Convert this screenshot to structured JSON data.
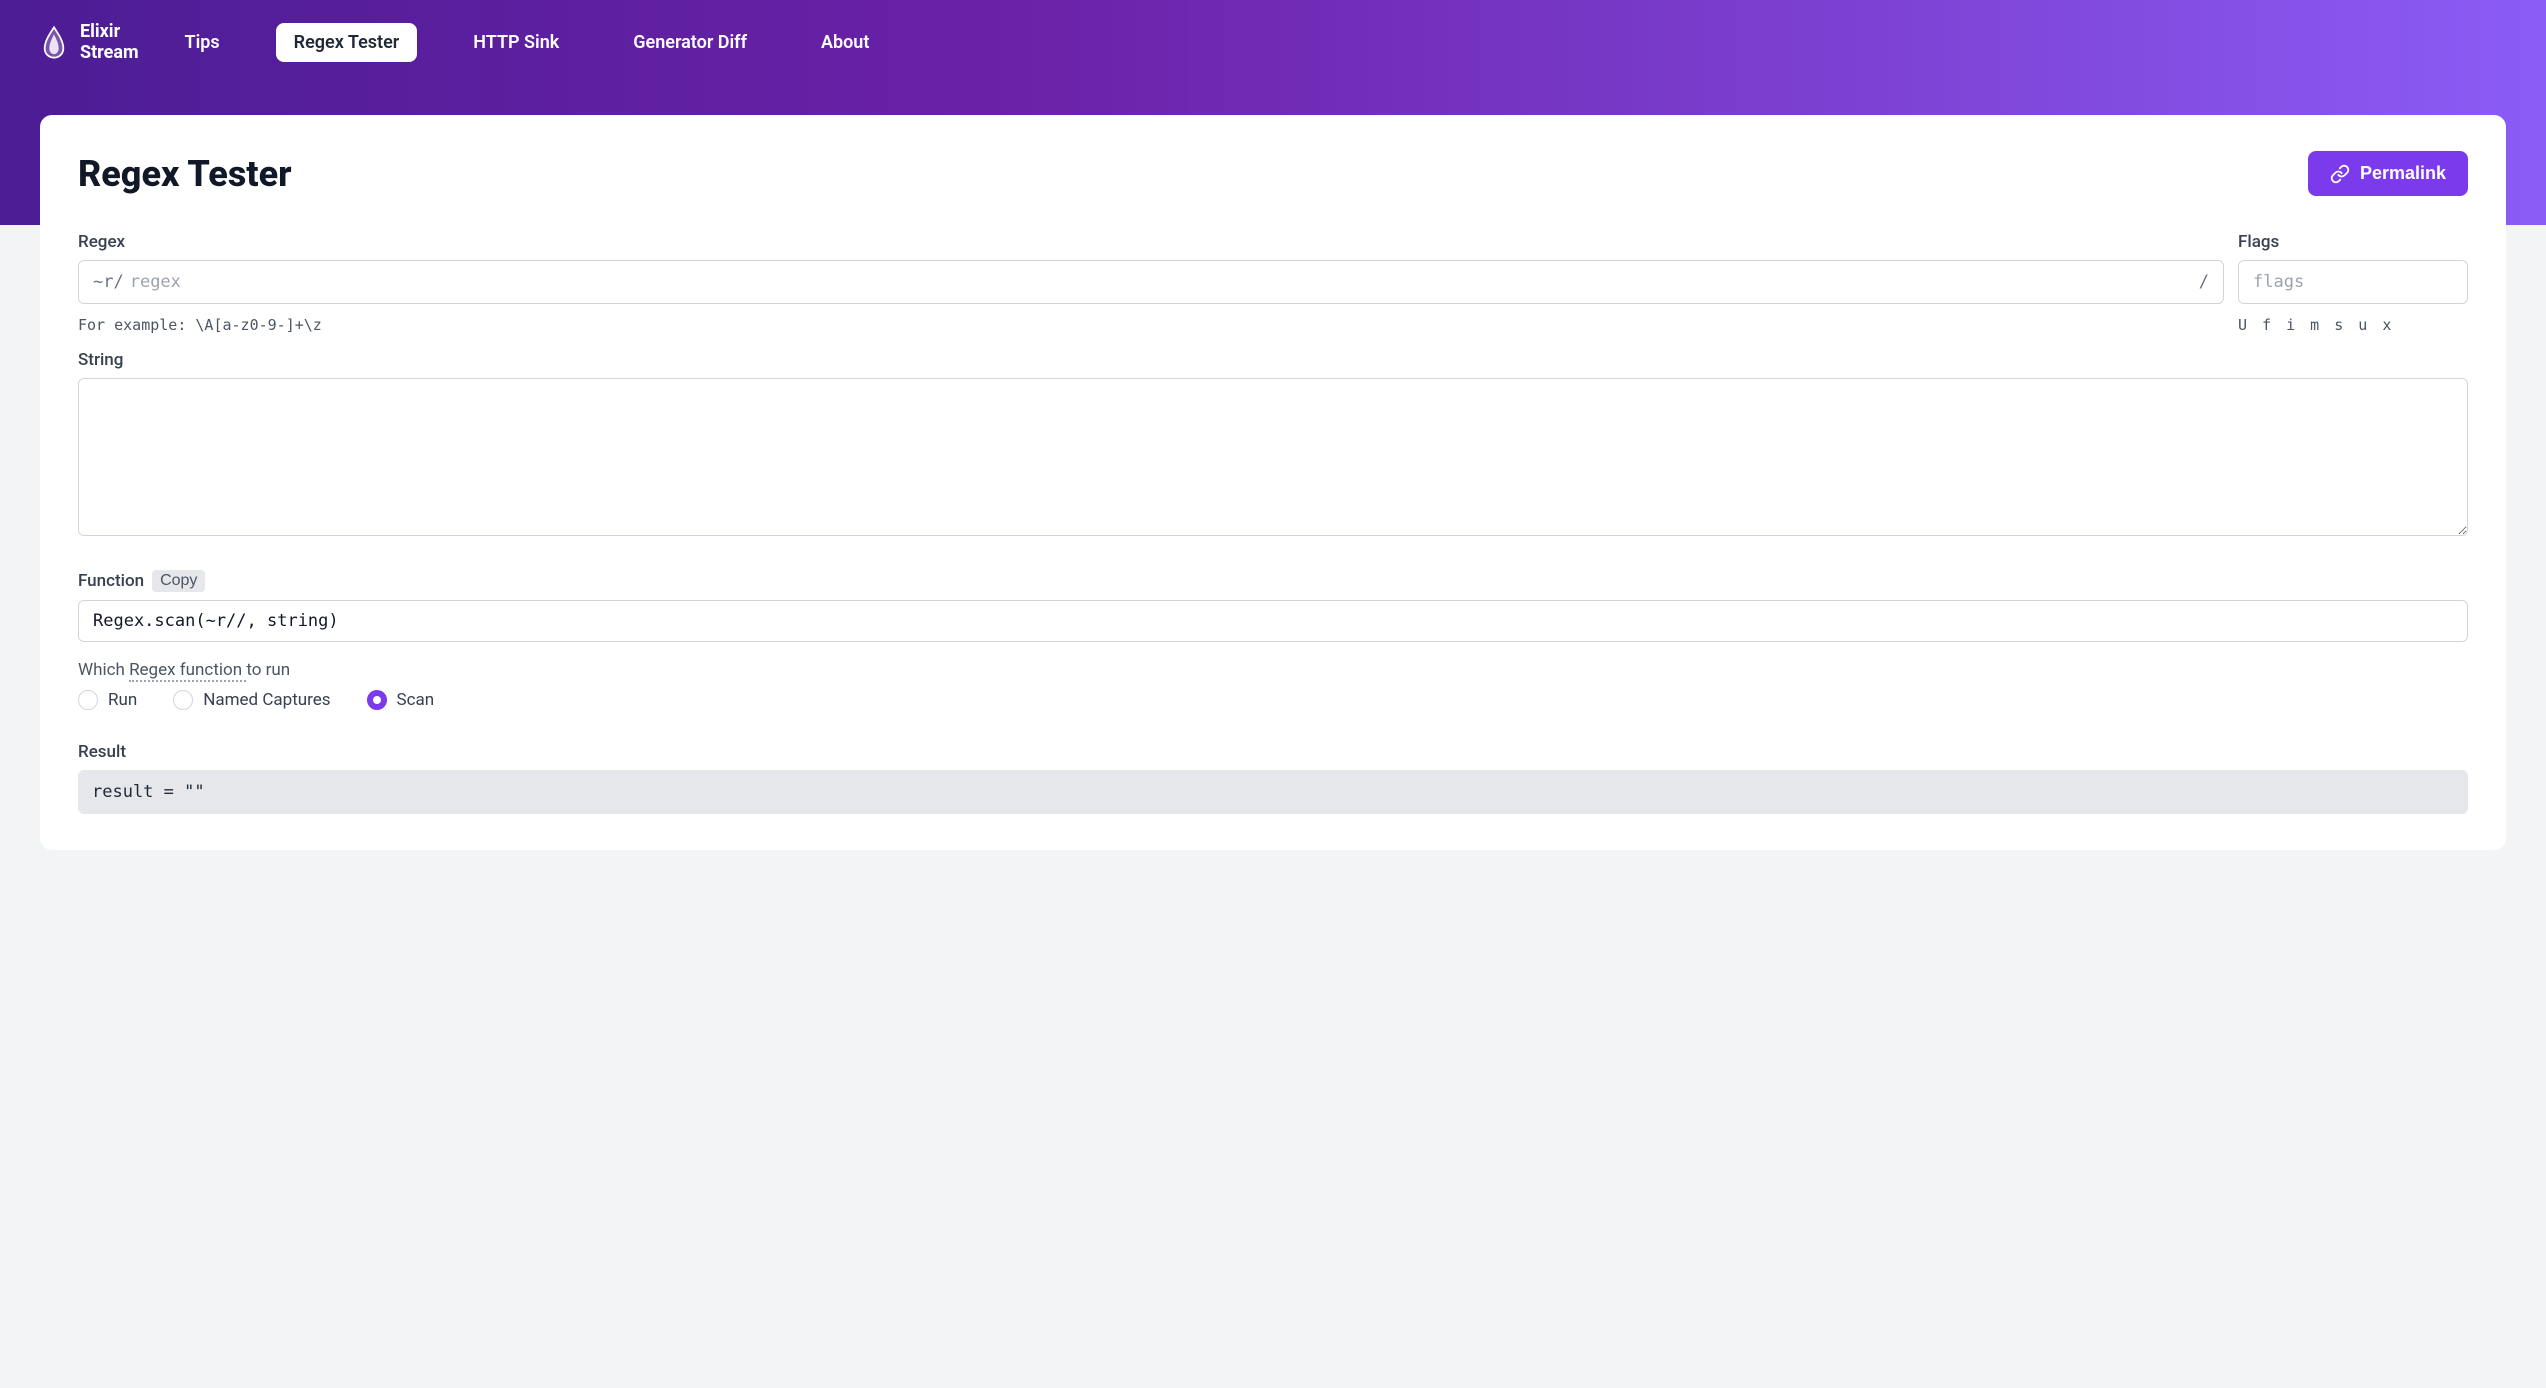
{
  "brand": {
    "name_line1": "Elixir",
    "name_line2": "Stream"
  },
  "nav": {
    "items": [
      {
        "label": "Tips"
      },
      {
        "label": "Regex Tester"
      },
      {
        "label": "HTTP Sink"
      },
      {
        "label": "Generator Diff"
      },
      {
        "label": "About"
      }
    ],
    "active_index": 1
  },
  "page": {
    "title": "Regex Tester",
    "permalink_label": "Permalink"
  },
  "regex": {
    "label": "Regex",
    "prefix": "~r/",
    "suffix": "/",
    "placeholder": "regex",
    "value": "",
    "hint": "For example: \\A[a-z0-9-]+\\z"
  },
  "flags": {
    "label": "Flags",
    "placeholder": "flags",
    "value": "",
    "hint": "U f i m s u x"
  },
  "string": {
    "label": "String",
    "value": ""
  },
  "function_block": {
    "label": "Function",
    "copy_label": "Copy",
    "code": "Regex.scan(~r//, string)",
    "which_prefix": "Which ",
    "which_link": "Regex function ",
    "which_suffix": "to run"
  },
  "radios": {
    "options": [
      {
        "label": "Run",
        "selected": false
      },
      {
        "label": "Named Captures",
        "selected": false
      },
      {
        "label": "Scan",
        "selected": true
      }
    ]
  },
  "result": {
    "label": "Result",
    "value": "result = \"\""
  }
}
